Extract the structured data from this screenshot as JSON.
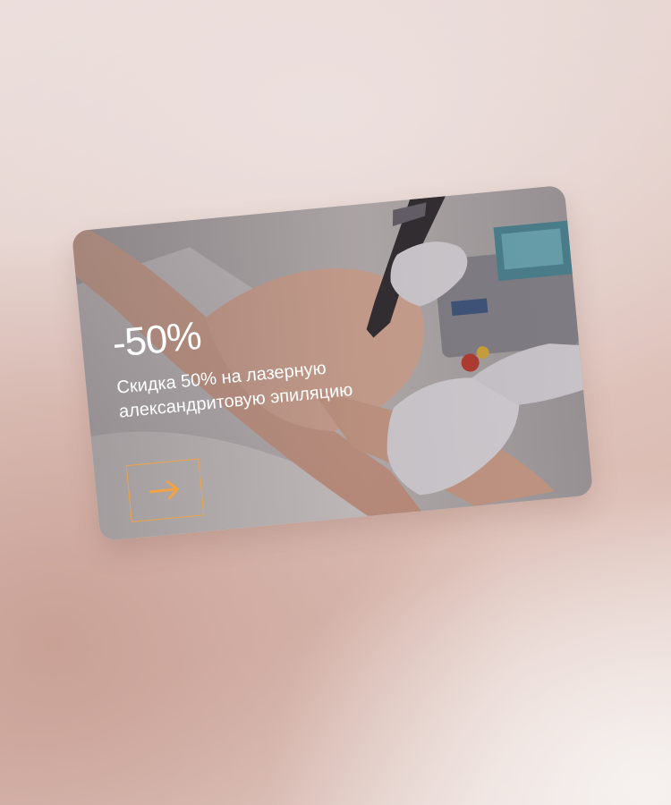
{
  "promo": {
    "discount": "-50%",
    "description": "Скидка 50% на лазерную александритовую эпиляцию",
    "photo_subject": "laser hair removal procedure on legs with medical device",
    "cta_icon": "arrow-right-icon"
  },
  "colors": {
    "accent": "#f0a345",
    "text": "#ffffff",
    "background_light": "#ebdedb",
    "background_rose": "#c9a196"
  }
}
